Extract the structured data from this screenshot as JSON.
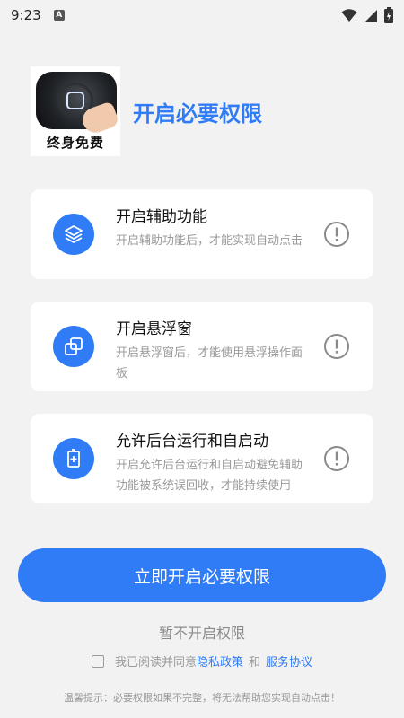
{
  "status_bar": {
    "time": "9:23",
    "notification_letter": "A"
  },
  "header": {
    "logo_caption": "终身免费",
    "title": "开启必要权限"
  },
  "permissions": [
    {
      "title": "开启辅助功能",
      "description": "开启辅助功能后，才能实现自动点击",
      "icon": "layers-icon"
    },
    {
      "title": "开启悬浮窗",
      "description": "开启悬浮窗后，才能使用悬浮操作面板",
      "icon": "overlay-window-icon"
    },
    {
      "title": "允许后台运行和自启动",
      "description": "开启允许后台运行和自启动避免辅助功能被系统误回收，才能持续使用",
      "icon": "battery-plus-icon"
    }
  ],
  "actions": {
    "primary": "立即开启必要权限",
    "skip": "暂不开启权限"
  },
  "agreement": {
    "prefix": "我已阅读并同意",
    "privacy": "隐私政策",
    "and": "和",
    "terms": "服务协议",
    "checked": false
  },
  "tip": "温馨提示：必要权限如果不完整，将无法帮助您实现自动点击！",
  "colors": {
    "accent": "#2f7cf6",
    "background": "#f2f2f2"
  }
}
